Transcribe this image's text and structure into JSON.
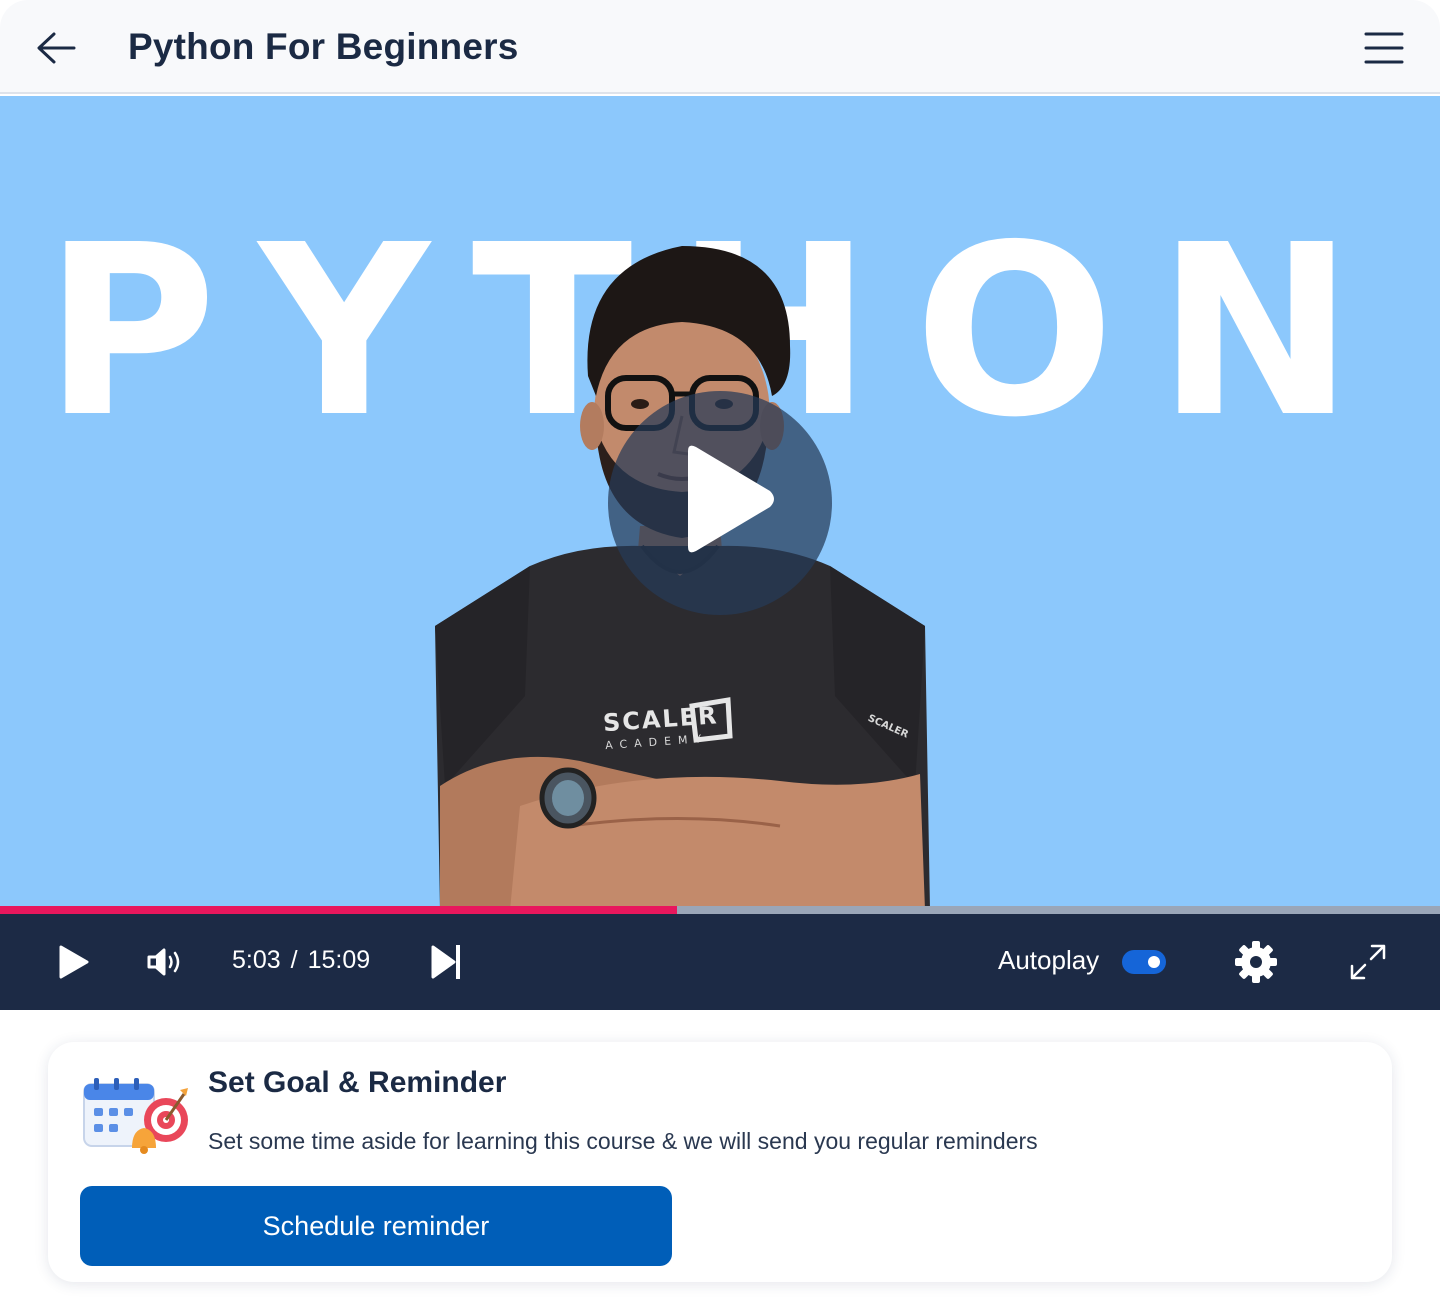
{
  "header": {
    "title": "Python For Beginners",
    "back_icon": "arrow-left-icon",
    "menu_icon": "hamburger-menu-icon"
  },
  "video": {
    "thumbnail_word": "PYTHON",
    "shirt_brand": "SCALER",
    "shirt_brand_sub": "ACADEMY",
    "sleeve_brand": "SCALER",
    "background_color": "#8cc8fc",
    "play_overlay_icon": "play-icon"
  },
  "player": {
    "progress_fraction": 0.47,
    "progress_color": "#e8175d",
    "current_time": "5:03",
    "time_separator": "/",
    "duration": "15:09",
    "autoplay_label": "Autoplay",
    "autoplay_enabled": true,
    "icons": {
      "play": "play-icon",
      "volume": "volume-icon",
      "next": "skip-next-icon",
      "settings": "gear-icon",
      "fullscreen": "expand-icon"
    },
    "bar_color": "#1c2a45"
  },
  "reminder_card": {
    "title": "Set Goal & Reminder",
    "description": "Set some time aside for learning this course & we will send you regular reminders",
    "button_label": "Schedule reminder",
    "illustration_icon": "calendar-target-bell-icon",
    "button_color": "#005eb8"
  }
}
